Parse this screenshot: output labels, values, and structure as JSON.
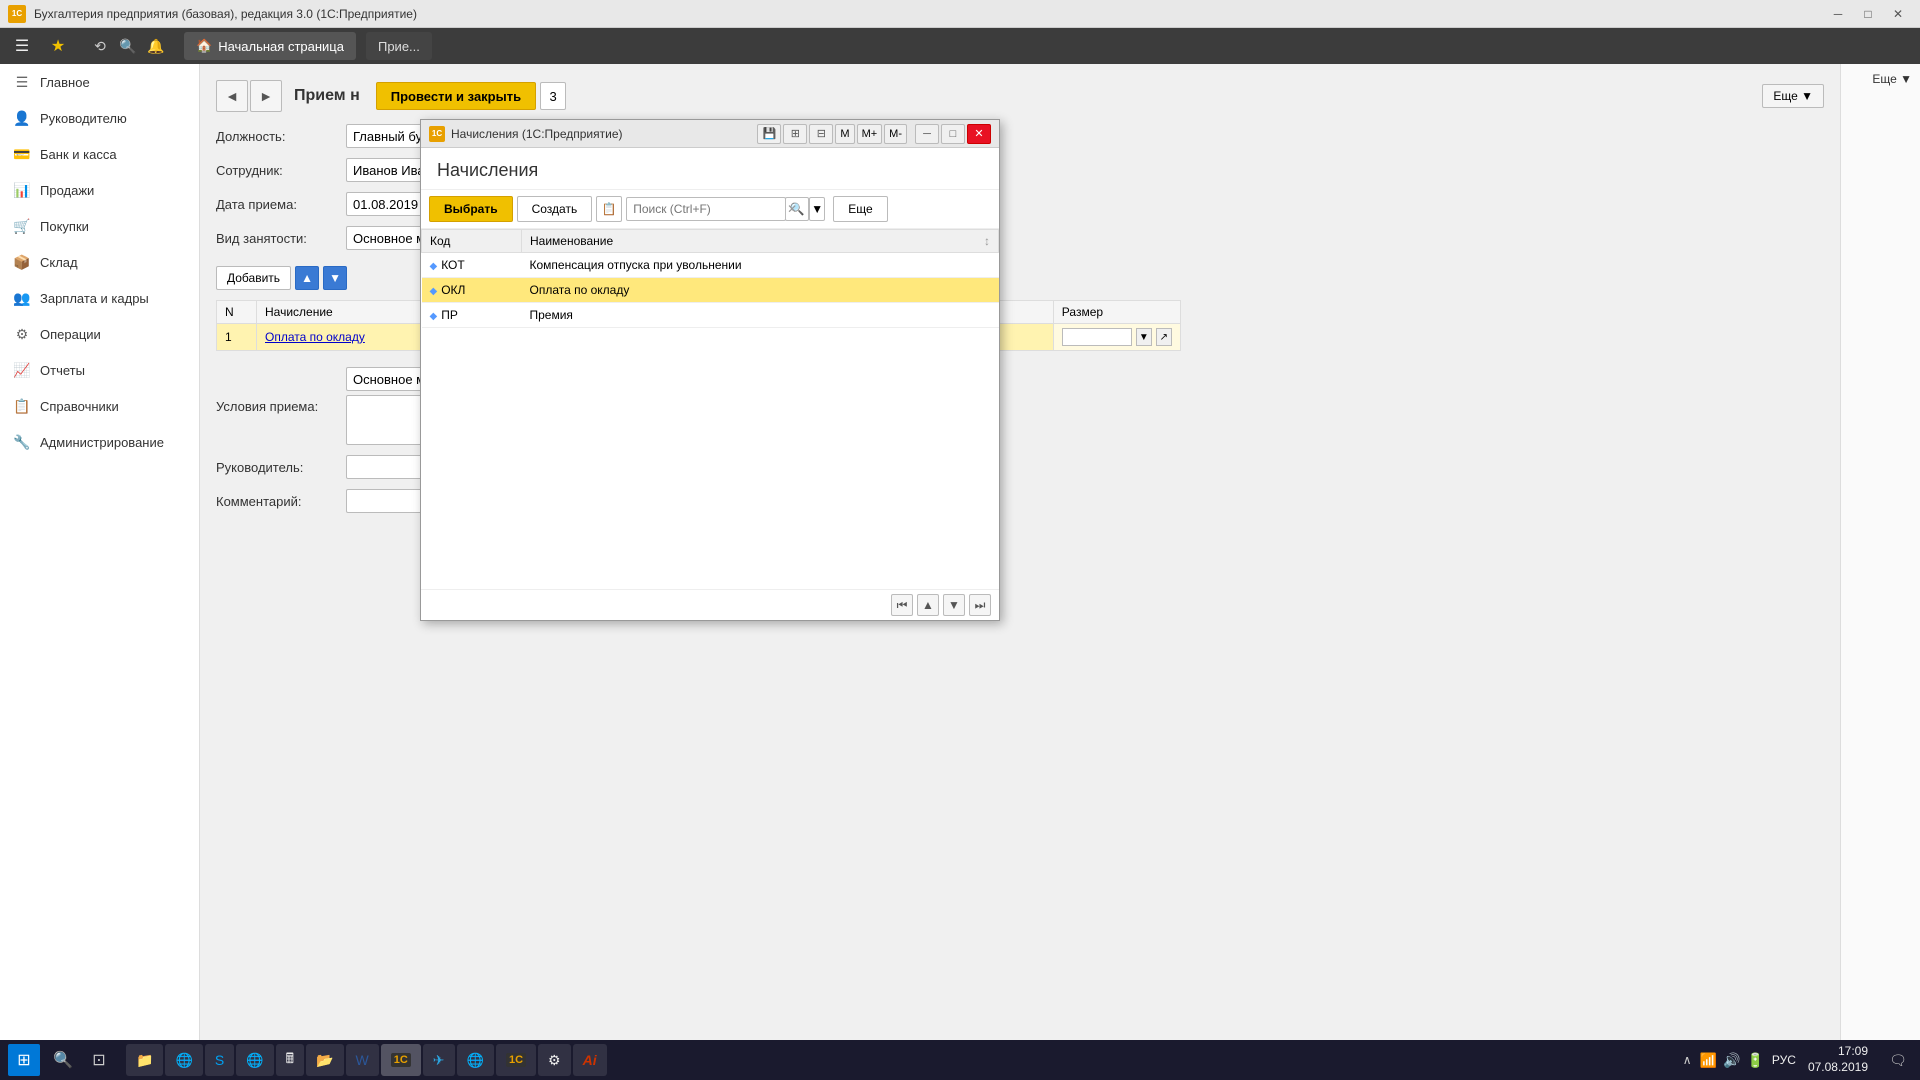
{
  "app": {
    "title": "Бухгалтерия предприятия (базовая), редакция 3.0 (1С:Предприятие)",
    "icon": "1С"
  },
  "top_menu": {
    "nav_back": "◄",
    "nav_forward": "►",
    "home_label": "Начальная страница",
    "tab_label": "Прие..."
  },
  "sidebar": {
    "items": [
      {
        "id": "main",
        "label": "Главное",
        "icon": "☰"
      },
      {
        "id": "management",
        "label": "Руководителю",
        "icon": "👤"
      },
      {
        "id": "bank",
        "label": "Банк и касса",
        "icon": "🏦"
      },
      {
        "id": "sales",
        "label": "Продажи",
        "icon": "📊"
      },
      {
        "id": "purchases",
        "label": "Покупки",
        "icon": "🛒"
      },
      {
        "id": "warehouse",
        "label": "Склад",
        "icon": "📦"
      },
      {
        "id": "salary",
        "label": "Зарплата и кадры",
        "icon": "👥"
      },
      {
        "id": "operations",
        "label": "Операции",
        "icon": "⚙"
      },
      {
        "id": "reports",
        "label": "Отчеты",
        "icon": "📈"
      },
      {
        "id": "directories",
        "label": "Справочники",
        "icon": "📋"
      },
      {
        "id": "admin",
        "label": "Администрирование",
        "icon": "🔧"
      }
    ]
  },
  "main_form": {
    "title": "Прием н",
    "save_close_btn": "Провести и закрыть",
    "number": "3",
    "fields": {
      "position_label": "Должность:",
      "position_value": "Главный бухга...",
      "employee_label": "Сотрудник:",
      "employee_value": "Иванов Иван И...",
      "date_label": "Дата приема:",
      "date_value": "01.08.2019",
      "employment_label": "Вид занятости:",
      "employment_value": "Основное мест..."
    },
    "table": {
      "add_btn": "Добавить",
      "up_btn": "▲",
      "down_btn": "▼",
      "columns": [
        {
          "id": "num",
          "label": "N"
        },
        {
          "id": "accrual",
          "label": "Начисление"
        },
        {
          "id": "size",
          "label": "Размер"
        }
      ],
      "rows": [
        {
          "num": "1",
          "accrual": "Оплата по окладу",
          "size": ""
        }
      ]
    },
    "conditions_label": "Условия приема:",
    "conditions_value": "Основное мест...",
    "manager_label": "Руководитель:",
    "manager_value": "",
    "comment_label": "Комментарий:",
    "comment_value": "",
    "more_btn": "Еще ▼"
  },
  "dialog": {
    "title_bar": "Начисления (1С:Предприятие)",
    "icon": "1С",
    "title": "Начисления",
    "buttons": {
      "select": "Выбрать",
      "create": "Создать"
    },
    "search_placeholder": "Поиск (Ctrl+F)",
    "clear_btn": "✕",
    "more_btn": "Еще",
    "columns": [
      {
        "id": "code",
        "label": "Код"
      },
      {
        "id": "name",
        "label": "Наименование"
      }
    ],
    "rows": [
      {
        "code": "КОТ",
        "name": "Компенсация отпуска при увольнении",
        "selected": false
      },
      {
        "code": "ОКЛ",
        "name": "Оплата по окладу",
        "selected": true
      },
      {
        "code": "ПР",
        "name": "Премия",
        "selected": false
      }
    ],
    "nav_buttons": {
      "first": "⏮",
      "prev": "◄",
      "next": "►",
      "last": "⏭"
    },
    "window_controls": {
      "minimize": "─",
      "restore": "□",
      "close": "✕"
    }
  },
  "taskbar": {
    "time": "17:09",
    "date": "07.08.2019",
    "lang": "РУС",
    "start_icon": "⊞",
    "apps": [
      {
        "label": "Ai",
        "active": false
      }
    ]
  }
}
